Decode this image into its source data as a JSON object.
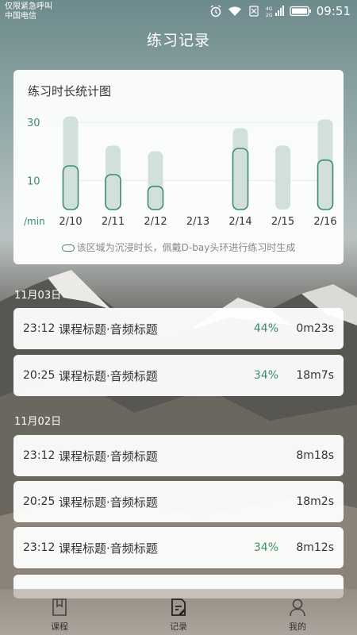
{
  "status_bar": {
    "carrier_line1": "仅限紧急呼叫",
    "carrier_line2": "中国电信",
    "network": "4G",
    "network2": "2G",
    "time": "09:51"
  },
  "page_title": "练习记录",
  "chart_card": {
    "title": "练习时长统计图",
    "legend": "该区域为沉浸时长，佩戴D-bay头环进行练习时生成"
  },
  "chart_data": {
    "type": "bar",
    "title": "练习时长统计图",
    "ylabel": "/min",
    "y_ticks": [
      "30",
      "10"
    ],
    "ylim": [
      0,
      36
    ],
    "categories": [
      "2/10",
      "2/11",
      "2/12",
      "2/13",
      "2/14",
      "2/15",
      "2/16"
    ],
    "series": [
      {
        "values": [
          32,
          22,
          20,
          0,
          28,
          22,
          31
        ]
      },
      {
        "name": "该区域为沉浸时长，佩戴D-bay头环进行练习时生成",
        "values": [
          15,
          12,
          8,
          0,
          21,
          0,
          17
        ]
      }
    ],
    "colors": {
      "total": "#d2e0dd",
      "immersion": "#3d8c6a"
    }
  },
  "groups": [
    {
      "date": "11月03日",
      "records": [
        {
          "time": "23:12",
          "title": "课程标题·音频标题",
          "percent": "44%",
          "duration": "0m23s"
        },
        {
          "time": "20:25",
          "title": "课程标题·音频标题",
          "percent": "34%",
          "duration": "18m7s"
        }
      ]
    },
    {
      "date": "11月02日",
      "records": [
        {
          "time": "23:12",
          "title": "课程标题·音频标题",
          "percent": "",
          "duration": "8m18s"
        },
        {
          "time": "20:25",
          "title": "课程标题·音频标题",
          "percent": "",
          "duration": "18m2s"
        },
        {
          "time": "23:12",
          "title": "课程标题·音频标题",
          "percent": "34%",
          "duration": "8m12s"
        }
      ]
    }
  ],
  "tabbar": {
    "tab1": "课程",
    "tab2": "记录",
    "tab3": "我的"
  }
}
